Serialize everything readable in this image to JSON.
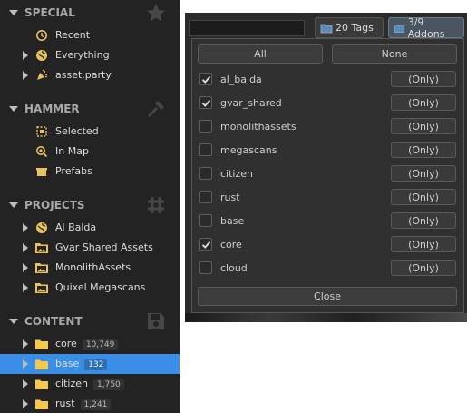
{
  "sidebar": {
    "sections": [
      {
        "title": "SPECIAL",
        "watermark": "star-icon",
        "items": [
          {
            "label": "Recent",
            "icon": "history-icon",
            "has_arrow": false
          },
          {
            "label": "Everything",
            "icon": "globe-icon",
            "has_arrow": true
          },
          {
            "label": "asset.party",
            "icon": "party-icon",
            "has_arrow": true
          }
        ]
      },
      {
        "title": "HAMMER",
        "watermark": "tools-icon",
        "items": [
          {
            "label": "Selected",
            "icon": "selection-icon",
            "has_arrow": false
          },
          {
            "label": "In Map",
            "icon": "map-search-icon",
            "has_arrow": false
          },
          {
            "label": "Prefabs",
            "icon": "prefab-icon",
            "has_arrow": false
          }
        ]
      },
      {
        "title": "PROJECTS",
        "watermark": "hash-icon",
        "items": [
          {
            "label": "Al Balda",
            "icon": "globe-icon",
            "has_arrow": true
          },
          {
            "label": "Gvar Shared Assets",
            "icon": "image-folder-icon",
            "has_arrow": true
          },
          {
            "label": "MonolithAssets",
            "icon": "image-folder-icon",
            "has_arrow": true
          },
          {
            "label": "Quixel Megascans",
            "icon": "image-folder-icon",
            "has_arrow": true
          }
        ]
      },
      {
        "title": "CONTENT",
        "watermark": "save-icon",
        "items": [
          {
            "label": "core",
            "count": "10,749",
            "icon": "folder-icon",
            "has_arrow": true
          },
          {
            "label": "base",
            "count": "132",
            "icon": "folder-icon",
            "has_arrow": true,
            "selected": true
          },
          {
            "label": "citizen",
            "count": "1,750",
            "icon": "folder-icon",
            "has_arrow": true
          },
          {
            "label": "rust",
            "count": "1,241",
            "icon": "folder-icon",
            "has_arrow": true
          }
        ]
      }
    ]
  },
  "toolbar": {
    "tags_label": "20 Tags",
    "addons_label": "3/9 Addons"
  },
  "addons_dropdown": {
    "all_label": "All",
    "none_label": "None",
    "close_label": "Close",
    "only_label": "(Only)",
    "addons": [
      {
        "name": "al_balda",
        "checked": true
      },
      {
        "name": "gvar_shared",
        "checked": true
      },
      {
        "name": "monolithassets",
        "checked": false
      },
      {
        "name": "megascans",
        "checked": false
      },
      {
        "name": "citizen",
        "checked": false
      },
      {
        "name": "rust",
        "checked": false
      },
      {
        "name": "base",
        "checked": false
      },
      {
        "name": "core",
        "checked": true
      },
      {
        "name": "cloud",
        "checked": false
      }
    ]
  },
  "colors": {
    "sidebar_bg": "#232323",
    "selection": "#3a8ee6",
    "folder": "#f2c94c",
    "accent_icon": "#e8c35a"
  }
}
